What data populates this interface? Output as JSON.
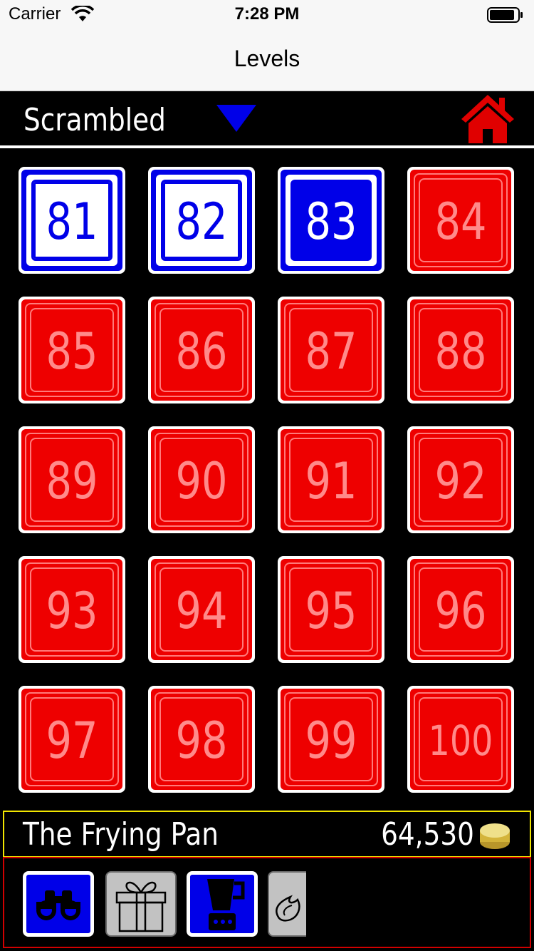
{
  "status_bar": {
    "carrier": "Carrier",
    "time": "7:28 PM"
  },
  "nav": {
    "title": "Levels"
  },
  "header": {
    "mode": "Scrambled"
  },
  "levels": [
    {
      "number": "81",
      "state": "unlocked"
    },
    {
      "number": "82",
      "state": "unlocked"
    },
    {
      "number": "83",
      "state": "current"
    },
    {
      "number": "84",
      "state": "locked"
    },
    {
      "number": "85",
      "state": "locked"
    },
    {
      "number": "86",
      "state": "locked"
    },
    {
      "number": "87",
      "state": "locked"
    },
    {
      "number": "88",
      "state": "locked"
    },
    {
      "number": "89",
      "state": "locked"
    },
    {
      "number": "90",
      "state": "locked"
    },
    {
      "number": "91",
      "state": "locked"
    },
    {
      "number": "92",
      "state": "locked"
    },
    {
      "number": "93",
      "state": "locked"
    },
    {
      "number": "94",
      "state": "locked"
    },
    {
      "number": "95",
      "state": "locked"
    },
    {
      "number": "96",
      "state": "locked"
    },
    {
      "number": "97",
      "state": "locked"
    },
    {
      "number": "98",
      "state": "locked"
    },
    {
      "number": "99",
      "state": "locked"
    },
    {
      "number": "100",
      "state": "locked"
    }
  ],
  "info": {
    "area_name": "The Frying Pan",
    "coins": "64,530"
  },
  "powerups": [
    {
      "icon": "binoculars-icon",
      "style": "blue"
    },
    {
      "icon": "gift-icon",
      "style": "gray"
    },
    {
      "icon": "blender-icon",
      "style": "blue"
    },
    {
      "icon": "flame-icon",
      "style": "gray-partial"
    }
  ],
  "colors": {
    "accent_blue": "#0000e8",
    "locked_red": "#ee0000",
    "locked_text": "#ff8a8a",
    "info_border": "#f2e600",
    "tray_border": "#d00000"
  }
}
